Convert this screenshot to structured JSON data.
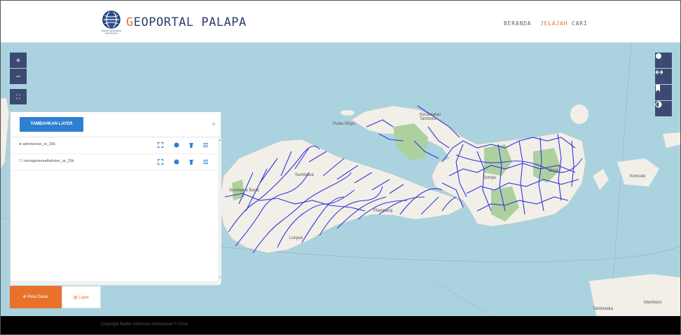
{
  "header": {
    "brand": {
      "first": "G",
      "rest": "EOPORTAL PALAPA"
    },
    "logo_caption": "BADAN INFORMASI GEOSPASIAL",
    "nav": [
      {
        "label": "BERANDA",
        "active": false
      },
      {
        "label": "JELAJAH",
        "active": true
      },
      {
        "label": "CARI",
        "active": false
      }
    ]
  },
  "map": {
    "labels": {
      "pulau_moyo": "Pulau Moyo",
      "kecamatan_tambora": "Kecamatan\nTambora",
      "komodo": "Komodo",
      "sumbawa_barat": "Sumbawa Barat",
      "sumbawa": "Sumbawa",
      "dompu": "Dompu",
      "bima": "Bima",
      "tambolaka": "Tambolaka",
      "mamboro": "Mamboro",
      "plampang": "Plampang",
      "lunyuk": "Lunyuk"
    },
    "controls_left": [
      {
        "icon": "plus-icon",
        "label": "+"
      },
      {
        "icon": "minus-icon",
        "label": "−"
      },
      {
        "icon": "fullscreen-icon",
        "label": "⛶"
      }
    ],
    "controls_right": [
      {
        "icon": "circle-icon"
      },
      {
        "icon": "swap-icon"
      },
      {
        "icon": "bookmark-icon"
      },
      {
        "icon": "contrast-icon"
      }
    ]
  },
  "panel": {
    "add_layer": "TAMBAHKAN LAYER",
    "close": "×",
    "layers": [
      {
        "name": "adminisrasi_ln_25k",
        "bullet": "●"
      },
      {
        "name": "rsimagrisematbeluker_ar_25k",
        "bullet": "☐"
      }
    ]
  },
  "tabs": {
    "peta_dasar": "Peta Dasar",
    "layer": "Layer"
  },
  "footer": {
    "copyright": "Copyright Badan Informasi Geospasial © 2016"
  },
  "colors": {
    "accent": "#e8722c",
    "button_blue": "#2f7fd0",
    "control_navy": "#3c4a72",
    "sea": "#aad3df",
    "land": "#f2efe9",
    "river": "#3535dc"
  }
}
